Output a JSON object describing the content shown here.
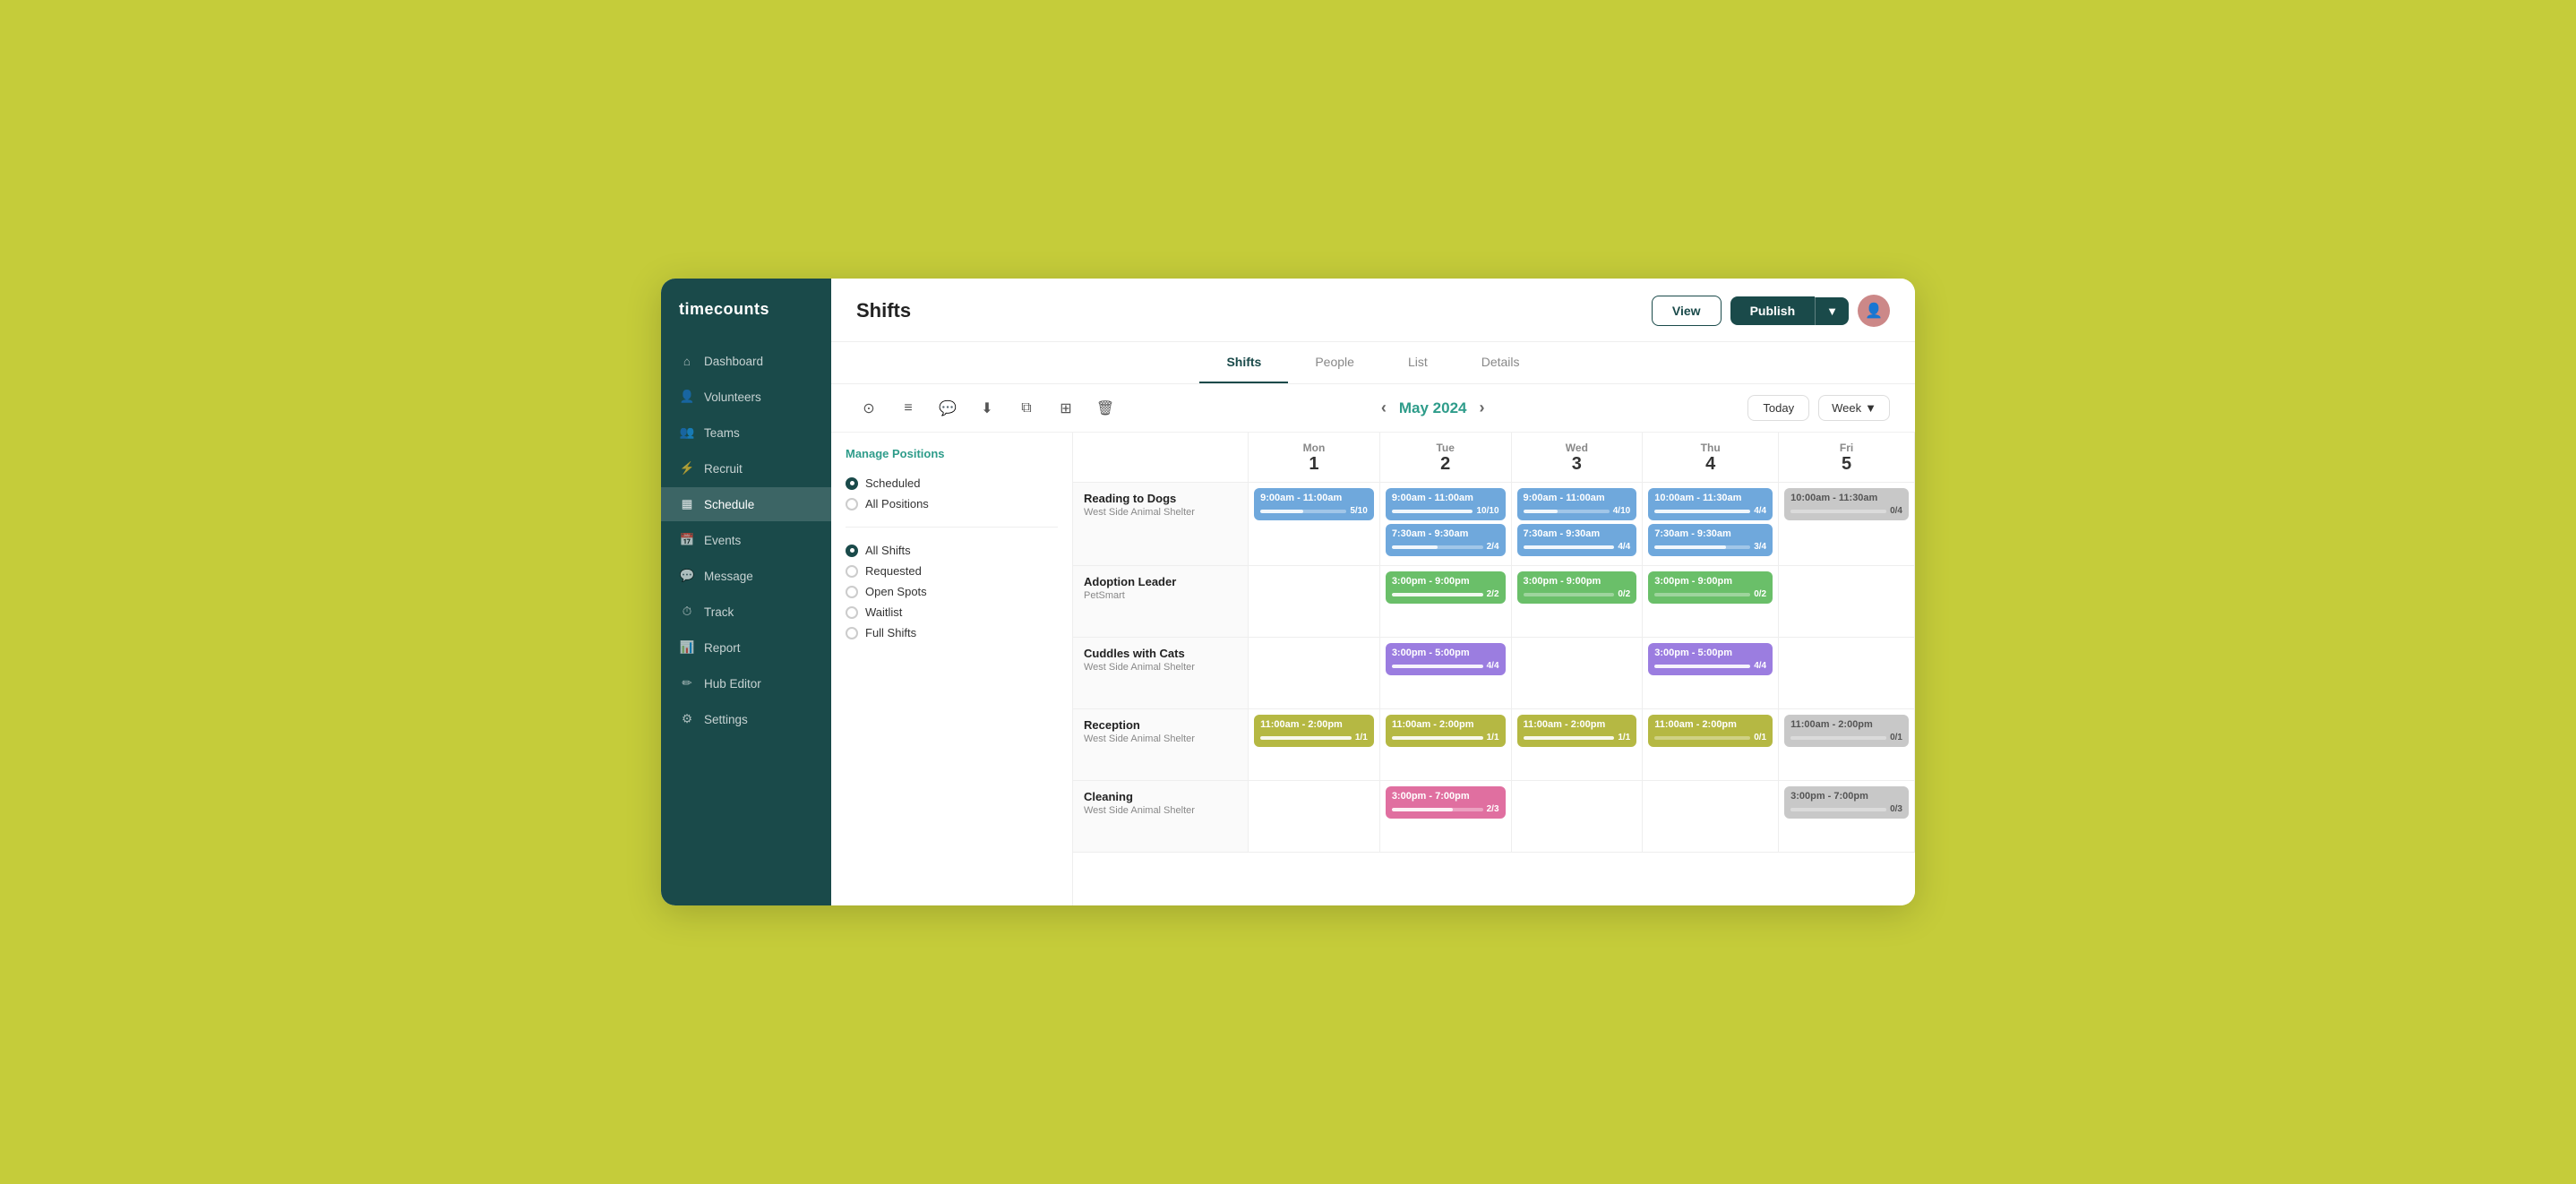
{
  "sidebar": {
    "logo": "timecounts",
    "items": [
      {
        "id": "dashboard",
        "label": "Dashboard",
        "icon": "home",
        "active": false
      },
      {
        "id": "volunteers",
        "label": "Volunteers",
        "icon": "user",
        "active": false
      },
      {
        "id": "teams",
        "label": "Teams",
        "icon": "users",
        "active": false
      },
      {
        "id": "recruit",
        "label": "Recruit",
        "icon": "bolt",
        "active": false
      },
      {
        "id": "schedule",
        "label": "Schedule",
        "icon": "grid",
        "active": true
      },
      {
        "id": "events",
        "label": "Events",
        "icon": "calendar",
        "active": false
      },
      {
        "id": "message",
        "label": "Message",
        "icon": "chat",
        "active": false
      },
      {
        "id": "track",
        "label": "Track",
        "icon": "clock",
        "active": false
      },
      {
        "id": "report",
        "label": "Report",
        "icon": "chart",
        "active": false
      },
      {
        "id": "hub-editor",
        "label": "Hub Editor",
        "icon": "edit",
        "active": false
      },
      {
        "id": "settings",
        "label": "Settings",
        "icon": "gear",
        "active": false
      }
    ]
  },
  "header": {
    "title": "Shifts",
    "view_label": "View",
    "publish_label": "Publish"
  },
  "tabs": [
    {
      "id": "shifts",
      "label": "Shifts",
      "active": true
    },
    {
      "id": "people",
      "label": "People",
      "active": false
    },
    {
      "id": "list",
      "label": "List",
      "active": false
    },
    {
      "id": "details",
      "label": "Details",
      "active": false
    }
  ],
  "toolbar": {
    "month_nav": "May 2024",
    "today_label": "Today",
    "week_label": "Week"
  },
  "left_panel": {
    "manage_positions": "Manage Positions",
    "filter_groups": [
      {
        "options": [
          {
            "id": "scheduled",
            "label": "Scheduled",
            "checked": true
          },
          {
            "id": "all-positions",
            "label": "All Positions",
            "checked": false
          }
        ]
      },
      {
        "options": [
          {
            "id": "all-shifts",
            "label": "All Shifts",
            "checked": true
          },
          {
            "id": "requested",
            "label": "Requested",
            "checked": false
          },
          {
            "id": "open-spots",
            "label": "Open Spots",
            "checked": false
          },
          {
            "id": "waitlist",
            "label": "Waitlist",
            "checked": false
          },
          {
            "id": "full-shifts",
            "label": "Full Shifts",
            "checked": false
          }
        ]
      }
    ]
  },
  "calendar": {
    "days": [
      {
        "name": "Mon",
        "num": "1"
      },
      {
        "name": "Tue",
        "num": "2"
      },
      {
        "name": "Wed",
        "num": "3"
      },
      {
        "name": "Thu",
        "num": "4"
      },
      {
        "name": "Fri",
        "num": "5"
      }
    ],
    "rows": [
      {
        "title": "Reading to Dogs",
        "subtitle": "West Side Animal Shelter",
        "shifts": [
          {
            "day": 0,
            "time": "9:00am - 11:00am",
            "count": "5/10",
            "fill_pct": 50,
            "color": "blue"
          },
          {
            "day": 1,
            "time": "9:00am - 11:00am",
            "count": "10/10",
            "fill_pct": 100,
            "color": "blue"
          },
          {
            "day": 1,
            "time": "7:30am - 9:30am",
            "count": "2/4",
            "fill_pct": 50,
            "color": "blue"
          },
          {
            "day": 2,
            "time": "9:00am - 11:00am",
            "count": "4/10",
            "fill_pct": 40,
            "color": "blue"
          },
          {
            "day": 2,
            "time": "7:30am - 9:30am",
            "count": "4/4",
            "fill_pct": 100,
            "color": "blue"
          },
          {
            "day": 3,
            "time": "10:00am - 11:30am",
            "count": "4/4",
            "fill_pct": 100,
            "color": "blue"
          },
          {
            "day": 3,
            "time": "7:30am - 9:30am",
            "count": "3/4",
            "fill_pct": 75,
            "color": "blue"
          },
          {
            "day": 4,
            "time": "10:00am - 11:30am",
            "count": "0/4",
            "fill_pct": 0,
            "color": "gray"
          }
        ]
      },
      {
        "title": "Adoption Leader",
        "subtitle": "PetSmart",
        "shifts": [
          {
            "day": 1,
            "time": "3:00pm - 9:00pm",
            "count": "2/2",
            "fill_pct": 100,
            "color": "green"
          },
          {
            "day": 2,
            "time": "3:00pm - 9:00pm",
            "count": "0/2",
            "fill_pct": 0,
            "color": "green"
          },
          {
            "day": 3,
            "time": "3:00pm - 9:00pm",
            "count": "0/2",
            "fill_pct": 0,
            "color": "green"
          }
        ]
      },
      {
        "title": "Cuddles with Cats",
        "subtitle": "West Side Animal Shelter",
        "shifts": [
          {
            "day": 1,
            "time": "3:00pm - 5:00pm",
            "count": "4/4",
            "fill_pct": 100,
            "color": "purple"
          },
          {
            "day": 3,
            "time": "3:00pm - 5:00pm",
            "count": "4/4",
            "fill_pct": 100,
            "color": "purple"
          }
        ]
      },
      {
        "title": "Reception",
        "subtitle": "West Side Animal Shelter",
        "shifts": [
          {
            "day": 0,
            "time": "11:00am - 2:00pm",
            "count": "1/1",
            "fill_pct": 100,
            "color": "olive"
          },
          {
            "day": 1,
            "time": "11:00am - 2:00pm",
            "count": "1/1",
            "fill_pct": 100,
            "color": "olive"
          },
          {
            "day": 2,
            "time": "11:00am - 2:00pm",
            "count": "1/1",
            "fill_pct": 100,
            "color": "olive"
          },
          {
            "day": 3,
            "time": "11:00am - 2:00pm",
            "count": "0/1",
            "fill_pct": 0,
            "color": "olive"
          },
          {
            "day": 4,
            "time": "11:00am - 2:00pm",
            "count": "0/1",
            "fill_pct": 0,
            "color": "gray"
          }
        ]
      },
      {
        "title": "Cleaning",
        "subtitle": "West Side Animal Shelter",
        "shifts": [
          {
            "day": 1,
            "time": "3:00pm - 7:00pm",
            "count": "2/3",
            "fill_pct": 67,
            "color": "pink"
          },
          {
            "day": 4,
            "time": "3:00pm - 7:00pm",
            "count": "0/3",
            "fill_pct": 0,
            "color": "gray"
          }
        ]
      }
    ]
  }
}
